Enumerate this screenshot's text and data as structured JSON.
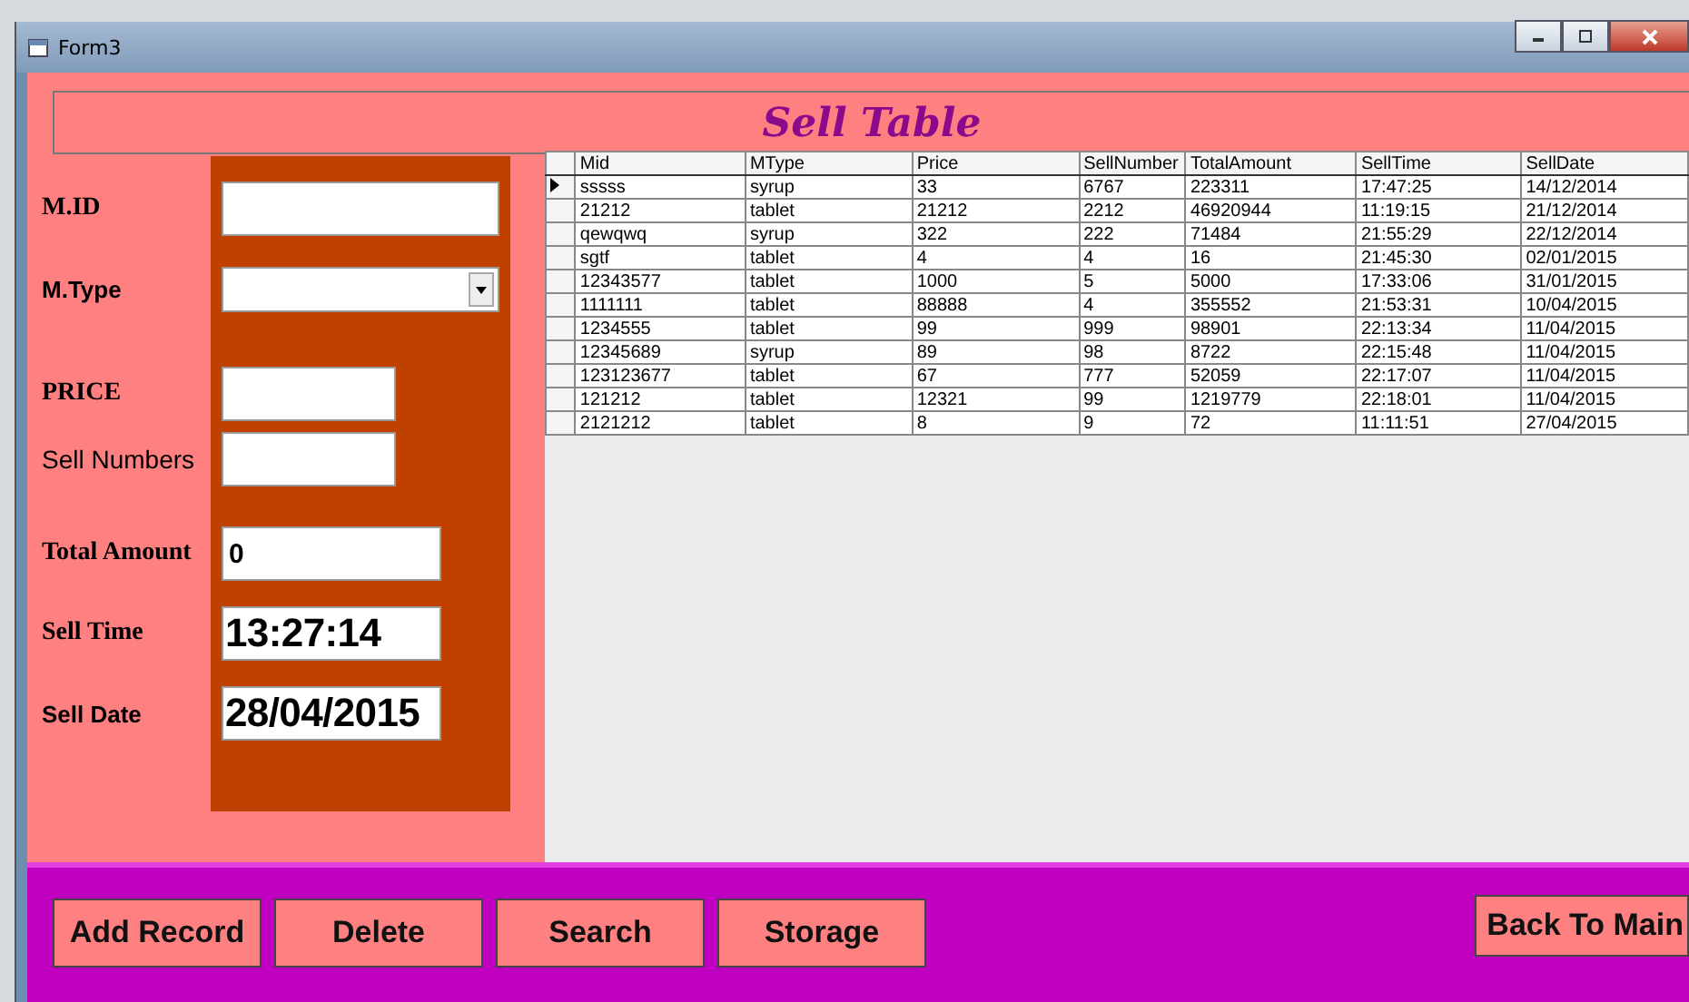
{
  "window": {
    "title": "Form3"
  },
  "banner": {
    "title": "Sell Table"
  },
  "form": [
    {
      "label": "M.ID",
      "kind": "text"
    },
    {
      "label": "M.Type",
      "kind": "dropdown"
    },
    {
      "label": "PRICE",
      "kind": "text"
    },
    {
      "label": "Sell Numbers",
      "kind": "text"
    },
    {
      "label": "Total Amount",
      "kind": "text",
      "value": "0"
    },
    {
      "label": "Sell Time",
      "kind": "big",
      "value": "13:27:14"
    },
    {
      "label": "Sell Date",
      "kind": "big",
      "value": "28/04/2015"
    }
  ],
  "table": {
    "columns": [
      "Mid",
      "MType",
      "Price",
      "SellNumber",
      "TotalAmount",
      "SellTime",
      "SellDate"
    ],
    "rows": [
      {
        "selected": true,
        "cells": [
          "sssss",
          "syrup",
          "33",
          "6767",
          "223311",
          "17:47:25",
          "14/12/2014"
        ]
      },
      {
        "selected": false,
        "cells": [
          "21212",
          "tablet",
          "21212",
          "2212",
          "46920944",
          "11:19:15",
          "21/12/2014"
        ]
      },
      {
        "selected": false,
        "cells": [
          "qewqwq",
          "syrup",
          "322",
          "222",
          "71484",
          "21:55:29",
          "22/12/2014"
        ]
      },
      {
        "selected": false,
        "cells": [
          "sgtf",
          "tablet",
          "4",
          "4",
          "16",
          "21:45:30",
          "02/01/2015"
        ]
      },
      {
        "selected": false,
        "cells": [
          "12343577",
          "tablet",
          "1000",
          "5",
          "5000",
          "17:33:06",
          "31/01/2015"
        ]
      },
      {
        "selected": false,
        "cells": [
          "1111111",
          "tablet",
          "88888",
          "4",
          "355552",
          "21:53:31",
          "10/04/2015"
        ]
      },
      {
        "selected": false,
        "cells": [
          "1234555",
          "tablet",
          "99",
          "999",
          "98901",
          "22:13:34",
          "11/04/2015"
        ]
      },
      {
        "selected": false,
        "cells": [
          "12345689",
          "syrup",
          "89",
          "98",
          "8722",
          "22:15:48",
          "11/04/2015"
        ]
      },
      {
        "selected": false,
        "cells": [
          "123123677",
          "tablet",
          "67",
          "777",
          "52059",
          "22:17:07",
          "11/04/2015"
        ]
      },
      {
        "selected": false,
        "cells": [
          "121212",
          "tablet",
          "12321",
          "99",
          "1219779",
          "22:18:01",
          "11/04/2015"
        ]
      },
      {
        "selected": false,
        "cells": [
          "2121212",
          "tablet",
          "8",
          "9",
          "72",
          "11:11:51",
          "27/04/2015"
        ]
      }
    ]
  },
  "buttons": [
    "Add Record",
    "Delete",
    "Search",
    "Storage"
  ],
  "back_button": "Back To Main"
}
